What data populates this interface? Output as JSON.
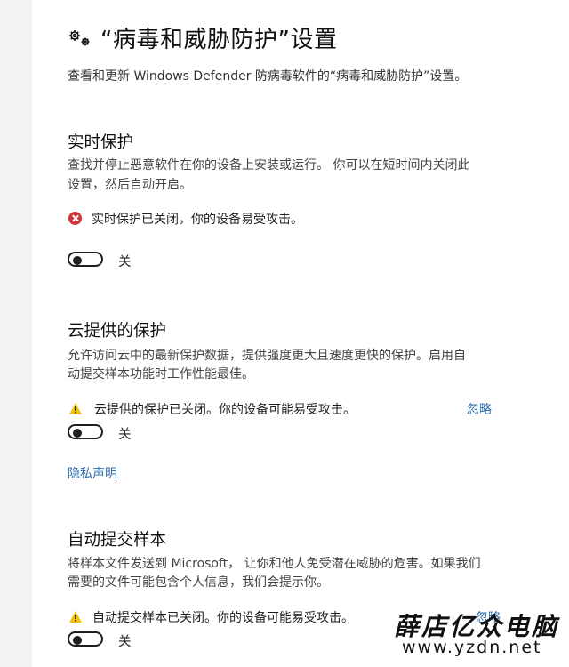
{
  "page": {
    "title": "“病毒和威胁防护”设置",
    "subtitle": "查看和更新 Windows Defender 防病毒软件的“病毒和威胁防护”设置。"
  },
  "realtime": {
    "heading": "实时保护",
    "desc_line1": "查找并停止恶意软件在你的设备上安装或运行。 你可以在短时间内关闭此",
    "desc_line2": "设置，然后自动开启。",
    "status": "实时保护已关闭，你的设备易受攻击。",
    "toggle_label": "关",
    "toggle_on": false
  },
  "cloud": {
    "heading": "云提供的保护",
    "desc_line1": "允许访问云中的最新保护数据，提供强度更大且速度更快的保护。启用自",
    "desc_line2": "动提交样本功能时工作性能最佳。",
    "status": "云提供的保护已关闭。你的设备可能易受攻击。",
    "dismiss": "忽略",
    "toggle_label": "关",
    "toggle_on": false,
    "privacy_link": "隐私声明"
  },
  "sample": {
    "heading": "自动提交样本",
    "desc_line1": "将样本文件发送到 Microsoft， 让你和他人免受潜在威胁的危害。如果我们",
    "desc_line2": "需要的文件可能包含个人信息，我们会提示你。",
    "status": "自动提交样本已关闭。你的设备可能易受攻击。",
    "dismiss": "忽略",
    "toggle_label": "关",
    "toggle_on": false
  },
  "watermark": {
    "text_cn": "薛店亿众电脑",
    "url": "www.yzdn.net"
  },
  "colors": {
    "link": "#2f6fb0",
    "error": "#d13438",
    "warning": "#f4c20d"
  }
}
